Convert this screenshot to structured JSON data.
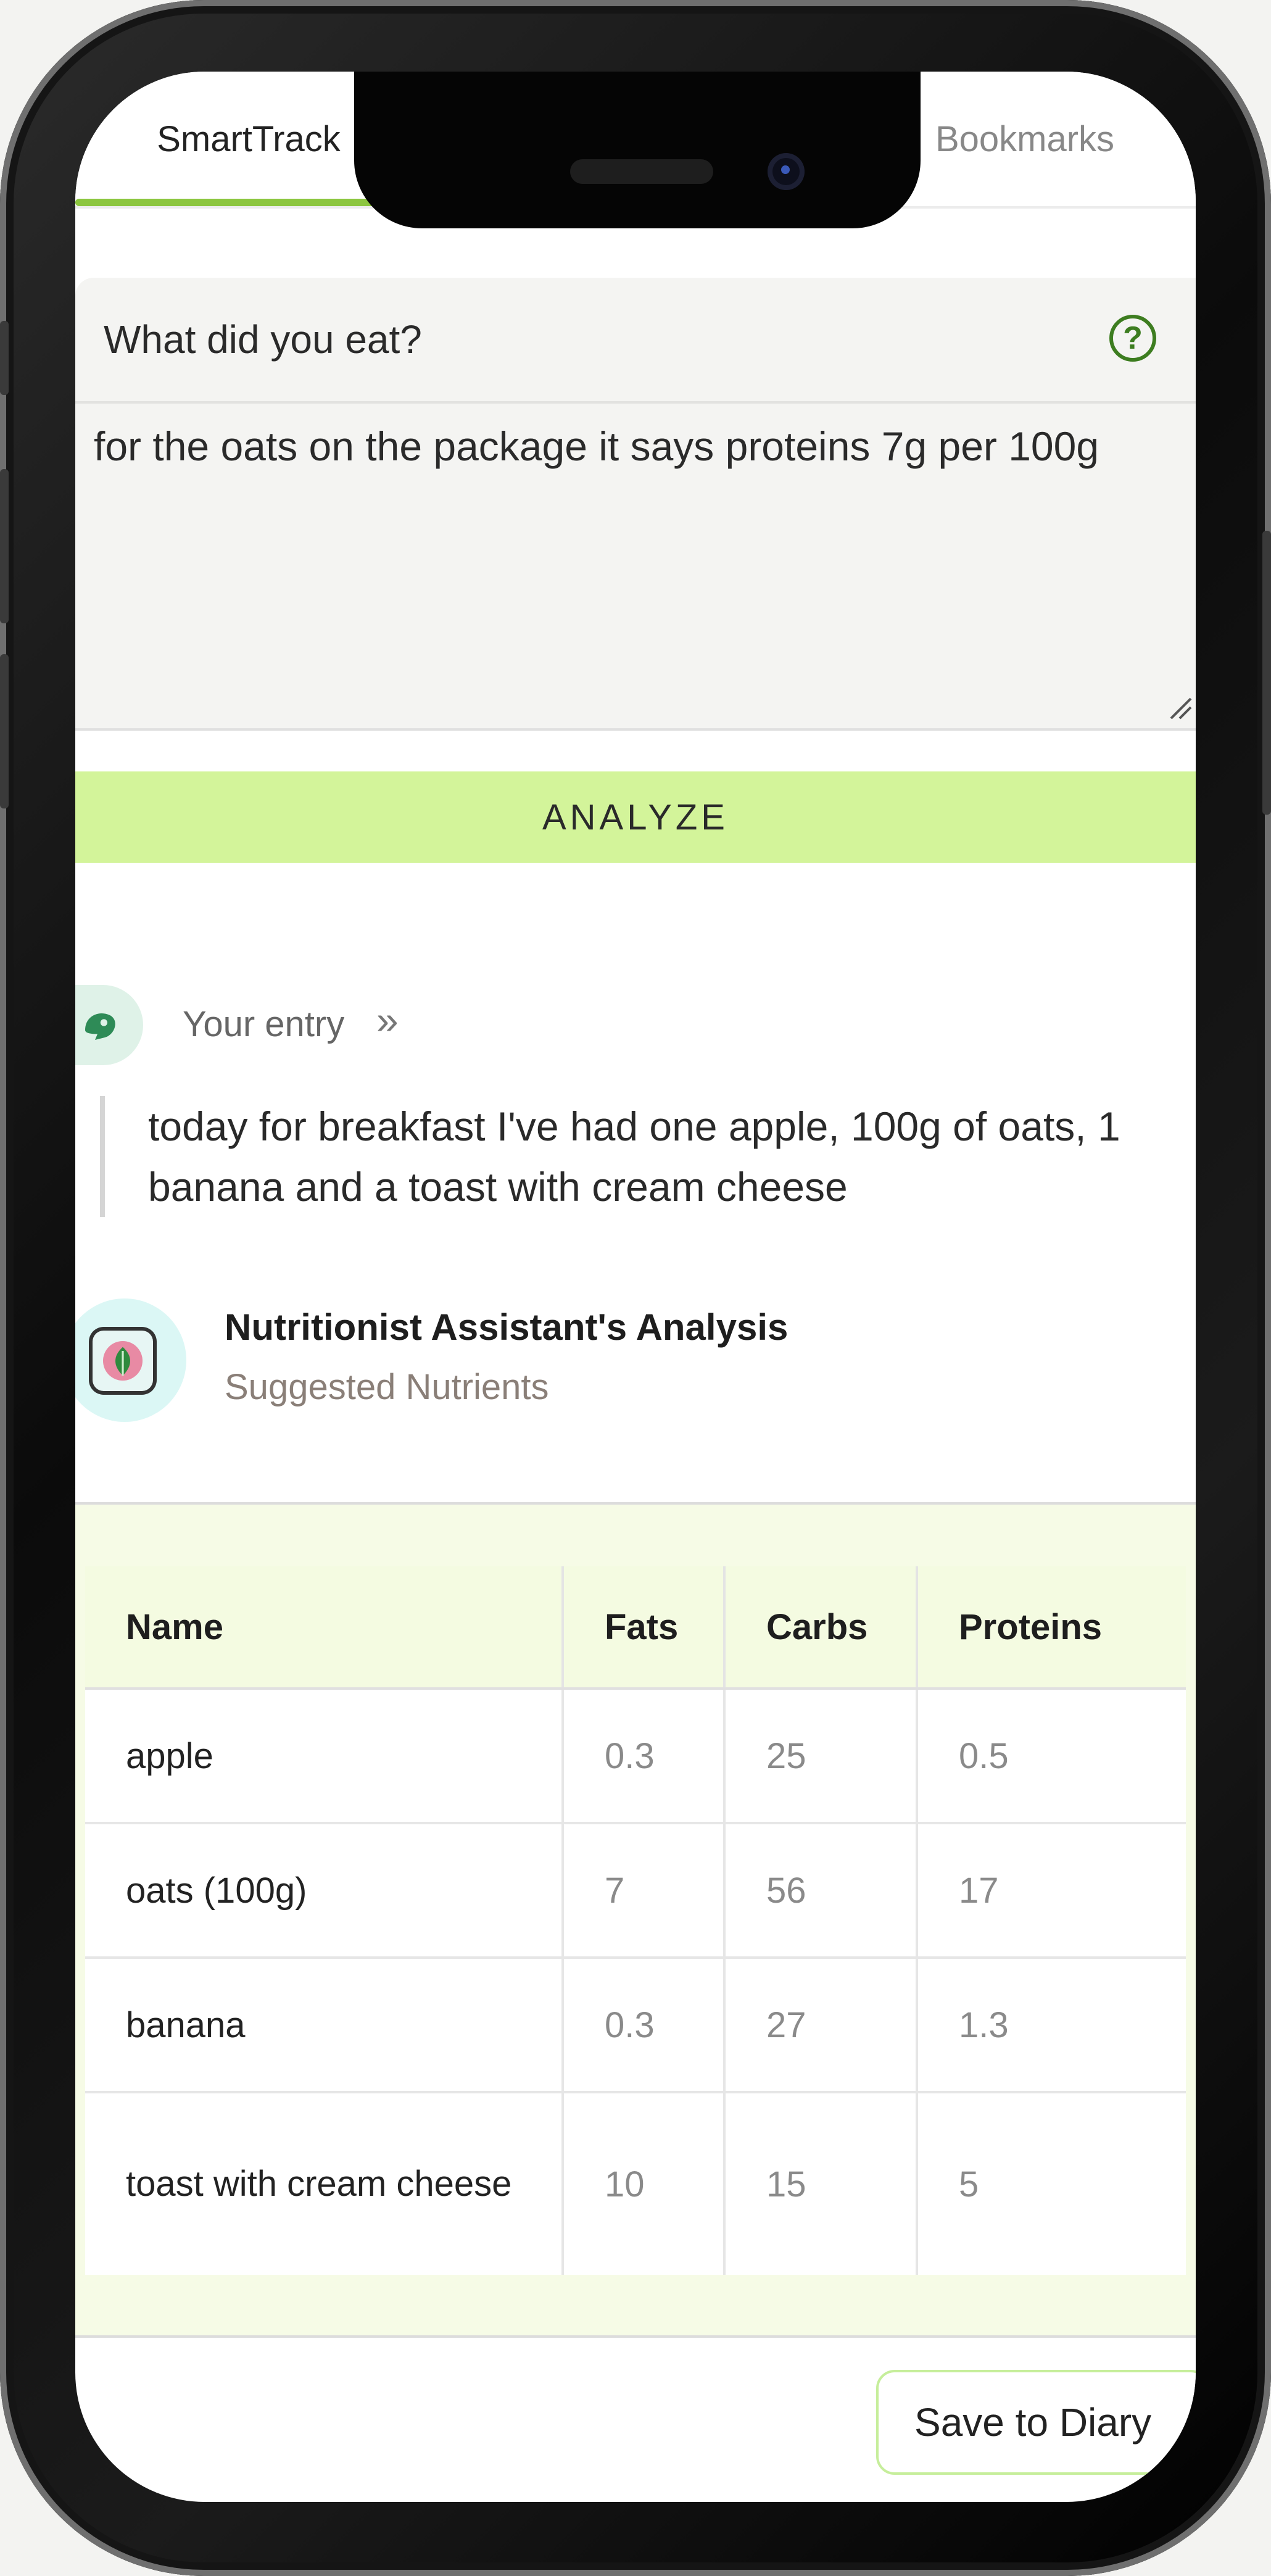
{
  "tabs": [
    {
      "label": "SmartTrack",
      "active": true
    },
    {
      "label": "",
      "active": false
    },
    {
      "label": "Bookmarks",
      "active": false
    }
  ],
  "input": {
    "title": "What did you eat?",
    "help_icon": "?",
    "value": "for the oats on the package it says proteins 7g per 100g"
  },
  "analyze_label": "ANALYZE",
  "entry": {
    "label": "Your entry",
    "chevron": "»",
    "text": "today for breakfast I've had one apple, 100g of oats, 1 banana and a toast with cream cheese"
  },
  "assistant": {
    "title": "Nutritionist Assistant's Analysis",
    "subtitle": "Suggested Nutrients"
  },
  "table": {
    "headers": [
      "Name",
      "Fats",
      "Carbs",
      "Proteins"
    ],
    "rows": [
      [
        "apple",
        "0.3",
        "25",
        "0.5"
      ],
      [
        "oats (100g)",
        "7",
        "56",
        "17"
      ],
      [
        "banana",
        "0.3",
        "27",
        "1.3"
      ],
      [
        "toast with cream cheese",
        "10",
        "15",
        "5"
      ]
    ]
  },
  "save_label": "Save to Diary",
  "colors": {
    "accent": "#8cc63f",
    "analyze_bg": "#d3f49a",
    "table_bg": "#f6fbe6",
    "help_icon": "#3d7d20"
  }
}
